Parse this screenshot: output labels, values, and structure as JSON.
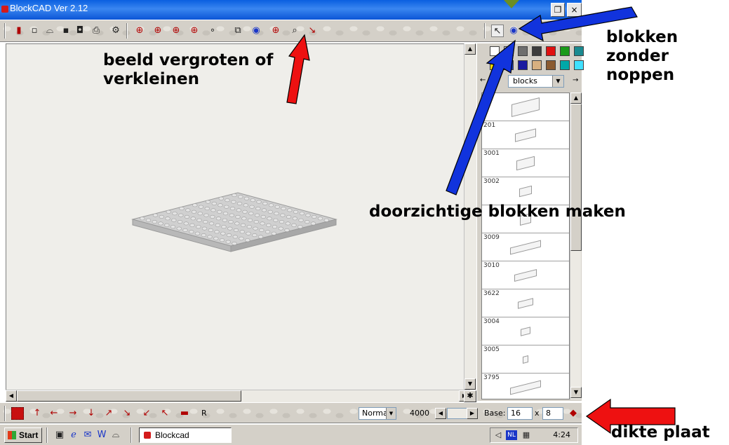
{
  "window": {
    "title": "BlockCAD Ver 2.12",
    "minimize_glyph": "_",
    "restore_glyph": "❐",
    "close_glyph": "×"
  },
  "toolbar_top": {
    "icons": [
      "lego-brick-icon",
      "new-file-icon",
      "open-folder-icon",
      "save-icon",
      "camera-icon",
      "print-icon",
      "gear-icon",
      "rotate-left-icon",
      "rotate-up-icon",
      "rotate-down-icon",
      "rotate-right-icon",
      "stud-icon",
      "copy-icon",
      "eye-icon",
      "zoom-in-icon",
      "zoom-out-icon",
      "curve-icon"
    ],
    "right_icons": [
      "select-arrow-icon",
      "transparent-eye-icon",
      "no-studs-icon"
    ]
  },
  "palette": {
    "colors": [
      "#ffffff",
      "#c8c8c8",
      "#6e6e6e",
      "#3c3c3c",
      "#e01010",
      "#1a9a1a",
      "#1a8a90",
      "#f0d800",
      "#1a3cc8",
      "#1a1aa0",
      "#d8b080",
      "#8a5a30",
      "#00a8a8",
      "#40e0ff"
    ],
    "category": "blocks",
    "left_arrow": "←",
    "right_arrow": "→"
  },
  "parts": [
    {
      "id": ""
    },
    {
      "id": "201"
    },
    {
      "id": "3001"
    },
    {
      "id": "3002"
    },
    {
      "id": ""
    },
    {
      "id": "3009"
    },
    {
      "id": "3010"
    },
    {
      "id": "3622"
    },
    {
      "id": "3004"
    },
    {
      "id": "3005"
    },
    {
      "id": "3795"
    }
  ],
  "bottom_bar": {
    "icons": [
      "brick-grid-icon",
      "arrow-up-icon",
      "arrow-left-icon",
      "arrow-right-icon",
      "arrow-down-icon",
      "arrow-ne-icon",
      "arrow-se-icon",
      "arrow-sw-icon",
      "arrow-nw-icon",
      "brick-icon"
    ],
    "r_label": "R",
    "mode_value": "Normal",
    "part_count": "4000",
    "base_label": "Base:",
    "base_width": "16",
    "base_x": "x",
    "base_depth": "8",
    "canvas_star": "✱"
  },
  "taskbar": {
    "start_label": "Start",
    "task_label": "Blockcad",
    "language": "NL",
    "clock": "4:24"
  },
  "annotations": {
    "zoom": "beeld vergroten of verkleinen",
    "no_studs": "blokken zonder noppen",
    "transparent": "doorzichtige blokken maken",
    "thickness": "dikte plaat"
  }
}
